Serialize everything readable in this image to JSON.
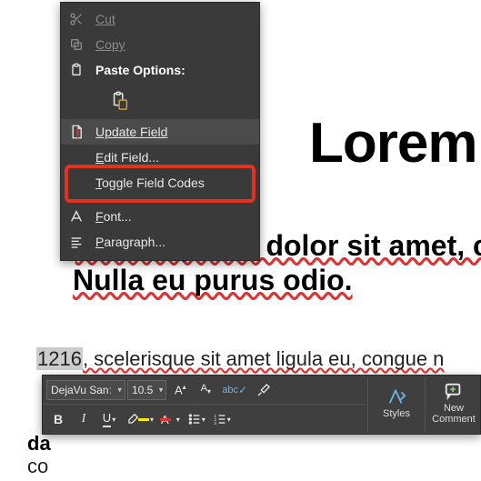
{
  "document": {
    "title": "Lorem",
    "subtitle_line1": "Lorem ipsum dolor sit amet, co",
    "subtitle_line2": "Nulla eu purus odio.",
    "body_field_value": "1216",
    "body_after": ", scelerisque sit amet ligula eu, congue n",
    "body_line2": "da",
    "body_line3": "co"
  },
  "context_menu": {
    "cut": "Cut",
    "copy": "Copy",
    "paste_options": "Paste Options:",
    "update_field": "Update Field",
    "edit_field": "Edit Field...",
    "toggle_field_codes": "Toggle Field Codes",
    "font": "Font...",
    "paragraph": "Paragraph..."
  },
  "mini_toolbar": {
    "font_name": "DejaVu San",
    "font_size": "10.5",
    "styles": "Styles",
    "new_comment": "New Comment"
  }
}
